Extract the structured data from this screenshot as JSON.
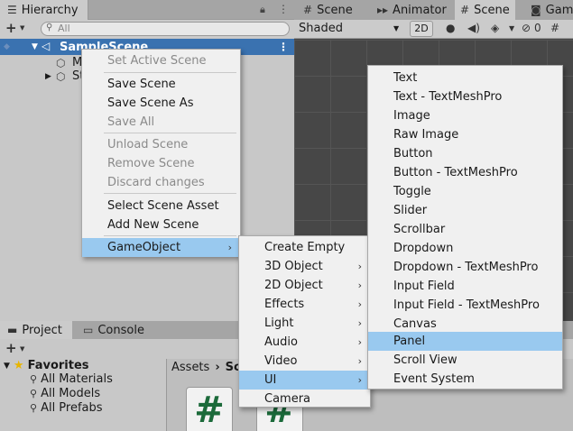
{
  "hierarchy": {
    "tab_label": "Hierarchy",
    "search_placeholder": "All",
    "scene_name": "SampleScene",
    "children": [
      "M",
      "St"
    ]
  },
  "scene_panel": {
    "tabs": [
      "Scene",
      "Animator",
      "Scene",
      "Game"
    ],
    "draw_mode": "Shaded",
    "mode_2d": "2D",
    "gizmo_count": "0"
  },
  "context_menu": {
    "items": [
      {
        "label": "Set Active Scene",
        "enabled": false
      },
      {
        "label": "Save Scene",
        "enabled": true
      },
      {
        "label": "Save Scene As",
        "enabled": true
      },
      {
        "label": "Save All",
        "enabled": false
      },
      {
        "label": "Unload Scene",
        "enabled": false
      },
      {
        "label": "Remove Scene",
        "enabled": false
      },
      {
        "label": "Discard changes",
        "enabled": false
      },
      {
        "label": "Select Scene Asset",
        "enabled": true
      },
      {
        "label": "Add New Scene",
        "enabled": true
      },
      {
        "label": "GameObject",
        "enabled": true,
        "highlighted": true
      }
    ]
  },
  "gameobject_menu": {
    "items": [
      "Create Empty",
      "3D Object",
      "2D Object",
      "Effects",
      "Light",
      "Audio",
      "Video",
      "UI",
      "Camera"
    ],
    "highlighted": "UI"
  },
  "ui_menu": {
    "items": [
      "Text",
      "Text - TextMeshPro",
      "Image",
      "Raw Image",
      "Button",
      "Button - TextMeshPro",
      "Toggle",
      "Slider",
      "Scrollbar",
      "Dropdown",
      "Dropdown - TextMeshPro",
      "Input Field",
      "Input Field - TextMeshPro",
      "Canvas",
      "Panel",
      "Scroll View",
      "Event System"
    ],
    "highlighted": "Panel"
  },
  "project": {
    "tabs": [
      "Project",
      "Console"
    ],
    "favorites_label": "Favorites",
    "favorites": [
      "All Materials",
      "All Models",
      "All Prefabs"
    ],
    "breadcrumb": [
      "Assets",
      "Scr"
    ],
    "asset_glyph": "#"
  },
  "colors": {
    "selection_blue": "#3a72b0",
    "menu_highlight": "#99c9ef",
    "script_green": "#1b6a3a"
  }
}
